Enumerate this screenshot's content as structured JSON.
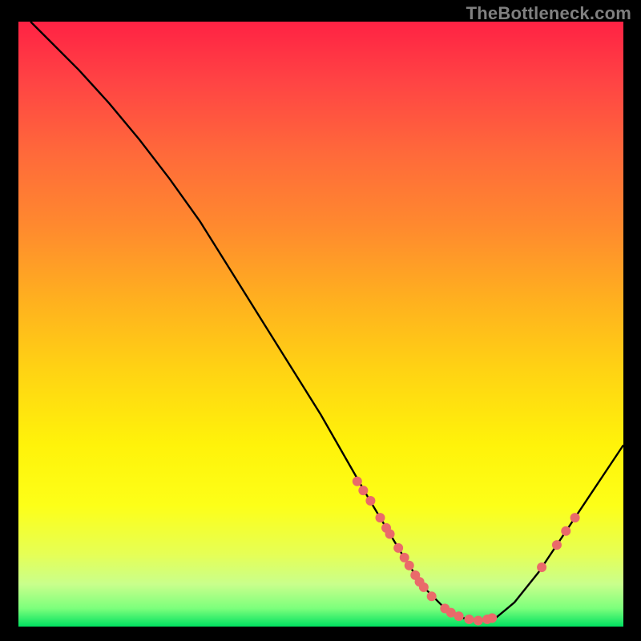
{
  "watermark": "TheBottleneck.com",
  "chart_data": {
    "type": "line",
    "title": "",
    "xlabel": "",
    "ylabel": "",
    "xlim": [
      0,
      100
    ],
    "ylim": [
      0,
      100
    ],
    "grid": false,
    "legend": false,
    "series": [
      {
        "name": "curve",
        "color": "#000000",
        "x": [
          2,
          5,
          10,
          15,
          20,
          25,
          30,
          35,
          40,
          45,
          50,
          54,
          58,
          61,
          64,
          67,
          70.5,
          73,
          76,
          79,
          82,
          86,
          90,
          94,
          100
        ],
        "values": [
          100,
          97,
          92,
          86.5,
          80.5,
          74,
          67,
          59,
          51,
          43,
          35,
          28,
          21,
          16,
          11,
          6.5,
          3,
          1.5,
          1,
          1.5,
          4,
          9,
          15,
          21,
          30
        ]
      }
    ],
    "marker_points": {
      "name": "dots",
      "color": "#ea6a6a",
      "radius": 6,
      "x": [
        56.0,
        57.0,
        58.2,
        59.8,
        60.8,
        61.4,
        62.8,
        63.8,
        64.6,
        65.6,
        66.3,
        67.0,
        68.3,
        70.5,
        71.5,
        72.8,
        74.5,
        76.0,
        77.5,
        78.3,
        86.5,
        89.0,
        90.5,
        92.0
      ],
      "values": [
        24.0,
        22.5,
        20.8,
        18.0,
        16.3,
        15.3,
        13.0,
        11.4,
        10.1,
        8.5,
        7.4,
        6.5,
        5.0,
        3.0,
        2.3,
        1.7,
        1.2,
        1.0,
        1.2,
        1.4,
        9.8,
        13.5,
        15.8,
        18.0
      ]
    }
  }
}
